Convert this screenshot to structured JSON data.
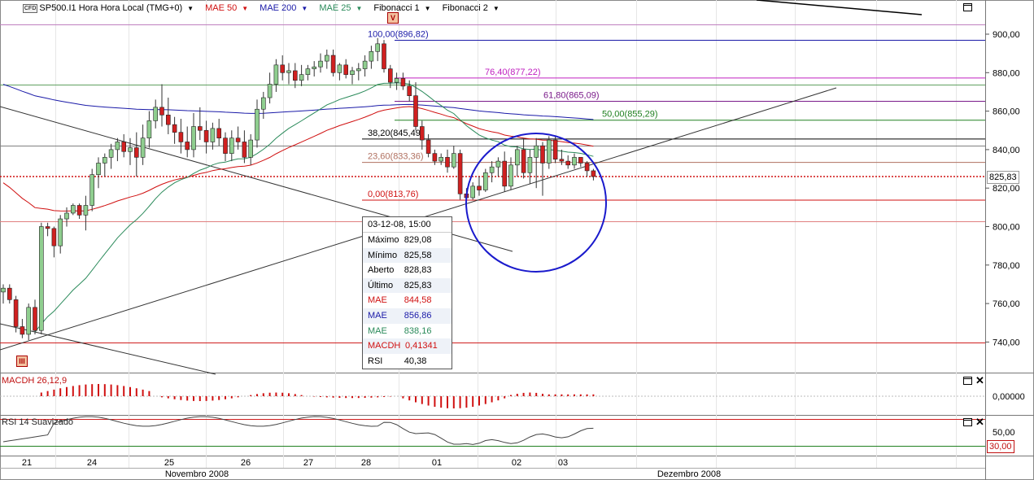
{
  "toolbar": {
    "symbol_badge": "CFD",
    "instrument": "SP500.I1 Hora Hora Local (TMG+0)",
    "indicators": [
      {
        "label": "MAE 50",
        "color": "#d01010"
      },
      {
        "label": "MAE 200",
        "color": "#1a1aa8"
      },
      {
        "label": "MAE 25",
        "color": "#2a8a5a"
      },
      {
        "label": "Fibonacci 1",
        "color": "#000000"
      },
      {
        "label": "Fibonacci 2",
        "color": "#000000"
      }
    ]
  },
  "markers": {
    "top": "V",
    "bottom": "III"
  },
  "chart_data": [
    {
      "type": "candlestick",
      "title": "SP500.I1 Hora Hora Local (TMG+0)",
      "y_ticks": [
        "900,00",
        "880,00",
        "860,00",
        "840,00",
        "820,00",
        "800,00",
        "780,00",
        "760,00",
        "740,00"
      ],
      "ylim": [
        735,
        912
      ],
      "x_day_labels": [
        "21",
        "24",
        "25",
        "26",
        "27",
        "28",
        "01",
        "02",
        "03"
      ],
      "x_month_labels": [
        "Novembro 2008",
        "Dezembro 2008"
      ],
      "last_price": "825,83",
      "candles": [
        [
          766,
          770,
          760,
          768
        ],
        [
          768,
          770,
          760,
          762
        ],
        [
          762,
          764,
          745,
          748
        ],
        [
          748,
          752,
          742,
          744
        ],
        [
          744,
          760,
          741,
          758
        ],
        [
          758,
          762,
          744,
          746
        ],
        [
          746,
          802,
          744,
          800
        ],
        [
          800,
          802,
          795,
          799
        ],
        [
          799,
          800,
          784,
          790
        ],
        [
          790,
          806,
          786,
          804
        ],
        [
          804,
          810,
          800,
          807
        ],
        [
          807,
          812,
          806,
          811
        ],
        [
          811,
          812,
          804,
          806
        ],
        [
          806,
          816,
          798,
          811
        ],
        [
          811,
          830,
          808,
          827
        ],
        [
          827,
          836,
          820,
          833
        ],
        [
          833,
          838,
          826,
          836
        ],
        [
          836,
          843,
          830,
          840
        ],
        [
          840,
          846,
          834,
          844
        ],
        [
          844,
          848,
          836,
          839
        ],
        [
          839,
          846,
          832,
          841
        ],
        [
          841,
          849,
          826,
          836
        ],
        [
          836,
          853,
          832,
          846
        ],
        [
          846,
          860,
          841,
          855
        ],
        [
          855,
          866,
          851,
          862
        ],
        [
          862,
          874,
          852,
          858
        ],
        [
          858,
          867,
          848,
          853
        ],
        [
          853,
          857,
          843,
          849
        ],
        [
          849,
          856,
          838,
          844
        ],
        [
          844,
          852,
          836,
          840
        ],
        [
          840,
          859,
          836,
          852
        ],
        [
          852,
          862,
          845,
          850
        ],
        [
          850,
          855,
          838,
          844
        ],
        [
          844,
          854,
          840,
          851
        ],
        [
          851,
          856,
          842,
          846
        ],
        [
          846,
          849,
          834,
          838
        ],
        [
          838,
          850,
          834,
          846
        ],
        [
          846,
          852,
          840,
          844
        ],
        [
          844,
          850,
          833,
          836
        ],
        [
          836,
          848,
          832,
          845
        ],
        [
          845,
          866,
          841,
          861
        ],
        [
          861,
          870,
          856,
          867
        ],
        [
          867,
          880,
          864,
          874
        ],
        [
          874,
          887,
          870,
          884
        ],
        [
          884,
          889,
          876,
          880
        ],
        [
          880,
          885,
          874,
          881
        ],
        [
          881,
          885,
          872,
          876
        ],
        [
          876,
          884,
          873,
          879
        ],
        [
          879,
          884,
          876,
          882
        ],
        [
          882,
          886,
          878,
          883
        ],
        [
          883,
          890,
          880,
          886
        ],
        [
          886,
          892,
          882,
          889
        ],
        [
          889,
          892,
          878,
          880
        ],
        [
          880,
          885,
          876,
          884
        ],
        [
          884,
          887,
          877,
          879
        ],
        [
          879,
          883,
          874,
          881
        ],
        [
          881,
          885,
          876,
          882
        ],
        [
          882,
          889,
          878,
          886
        ],
        [
          886,
          894,
          882,
          891
        ],
        [
          891,
          898,
          886,
          895
        ],
        [
          895,
          897,
          880,
          882
        ],
        [
          882,
          884,
          872,
          875
        ],
        [
          875,
          880,
          871,
          877
        ],
        [
          877,
          880,
          871,
          873
        ],
        [
          873,
          876,
          865,
          868
        ],
        [
          868,
          875,
          850,
          852
        ],
        [
          852,
          855,
          840,
          845
        ],
        [
          845,
          848,
          836,
          838
        ],
        [
          838,
          840,
          832,
          834
        ],
        [
          834,
          838,
          832,
          836
        ],
        [
          836,
          840,
          828,
          831
        ],
        [
          831,
          842,
          830,
          838
        ],
        [
          838,
          840,
          814,
          817
        ],
        [
          817,
          820,
          812,
          815
        ],
        [
          815,
          823,
          814,
          821
        ],
        [
          821,
          826,
          816,
          819
        ],
        [
          819,
          830,
          818,
          828
        ],
        [
          828,
          834,
          823,
          831
        ],
        [
          831,
          836,
          826,
          834
        ],
        [
          834,
          839,
          818,
          821
        ],
        [
          821,
          836,
          819,
          832
        ],
        [
          832,
          842,
          826,
          840
        ],
        [
          840,
          846,
          825,
          828
        ],
        [
          828,
          840,
          822,
          836
        ],
        [
          836,
          846,
          820,
          842
        ],
        [
          842,
          844,
          816,
          833
        ],
        [
          833,
          847,
          830,
          845
        ],
        [
          845,
          847,
          833,
          835
        ],
        [
          835,
          840,
          832,
          834
        ],
        [
          834,
          837,
          830,
          832
        ],
        [
          832,
          838,
          830,
          836
        ],
        [
          836,
          836,
          831,
          833
        ],
        [
          833,
          834,
          826,
          829
        ],
        [
          829,
          830,
          824,
          826
        ]
      ],
      "moving_averages": [
        {
          "name": "MAE 50",
          "value": "844,58",
          "color": "#d01010"
        },
        {
          "name": "MAE 200",
          "value": "856,86",
          "color": "#1a1aa8"
        },
        {
          "name": "MAE 25",
          "value": "838,16",
          "color": "#2a8a5a"
        }
      ],
      "fibonacci_levels": [
        {
          "label": "100,00(896,82)",
          "price": 896.82,
          "color": "#1a1aa8"
        },
        {
          "label": "76,40(877,22)",
          "price": 877.22,
          "color": "#c020c0"
        },
        {
          "label": "61,80(865,09)",
          "price": 865.09,
          "color": "#7a1a8a"
        },
        {
          "label": "50,00(855,29)",
          "price": 855.29,
          "color": "#208020"
        },
        {
          "label": "38,20(845,49)",
          "price": 845.49,
          "color": "#000000"
        },
        {
          "label": "23,60(833,36)",
          "price": 833.36,
          "color": "#b07060"
        },
        {
          "label": "0,00(813,76)",
          "price": 813.76,
          "color": "#d01010"
        }
      ]
    },
    {
      "type": "bar",
      "title": "MACDH 26,12,9",
      "y_ticks": [
        "0,00000"
      ],
      "value_label": "0,41341"
    },
    {
      "type": "line",
      "title": "RSI 14 Suavizado",
      "y_ticks": [
        "50,00"
      ],
      "level_label": "30,00",
      "value_label": "40,38"
    }
  ],
  "tooltip": {
    "datetime": "03-12-08, 15:00",
    "rows": [
      {
        "k": "Máximo",
        "v": "829,08",
        "color": "#000000"
      },
      {
        "k": "Mínimo",
        "v": "825,58",
        "color": "#000000"
      },
      {
        "k": "Aberto",
        "v": "828,83",
        "color": "#000000"
      },
      {
        "k": "Último",
        "v": "825,83",
        "color": "#000000"
      },
      {
        "k": "MAE",
        "v": "844,58",
        "color": "#d01010"
      },
      {
        "k": "MAE",
        "v": "856,86",
        "color": "#1a1aa8"
      },
      {
        "k": "MAE",
        "v": "838,16",
        "color": "#2a8a5a"
      },
      {
        "k": "MACDH",
        "v": "0,41341",
        "color": "#d01010"
      },
      {
        "k": "RSI",
        "v": "40,38",
        "color": "#000000"
      }
    ]
  },
  "colors": {
    "bull": "#8fce8f",
    "bear": "#d02020",
    "wick": "#333333",
    "circle": "#1a1acc"
  }
}
